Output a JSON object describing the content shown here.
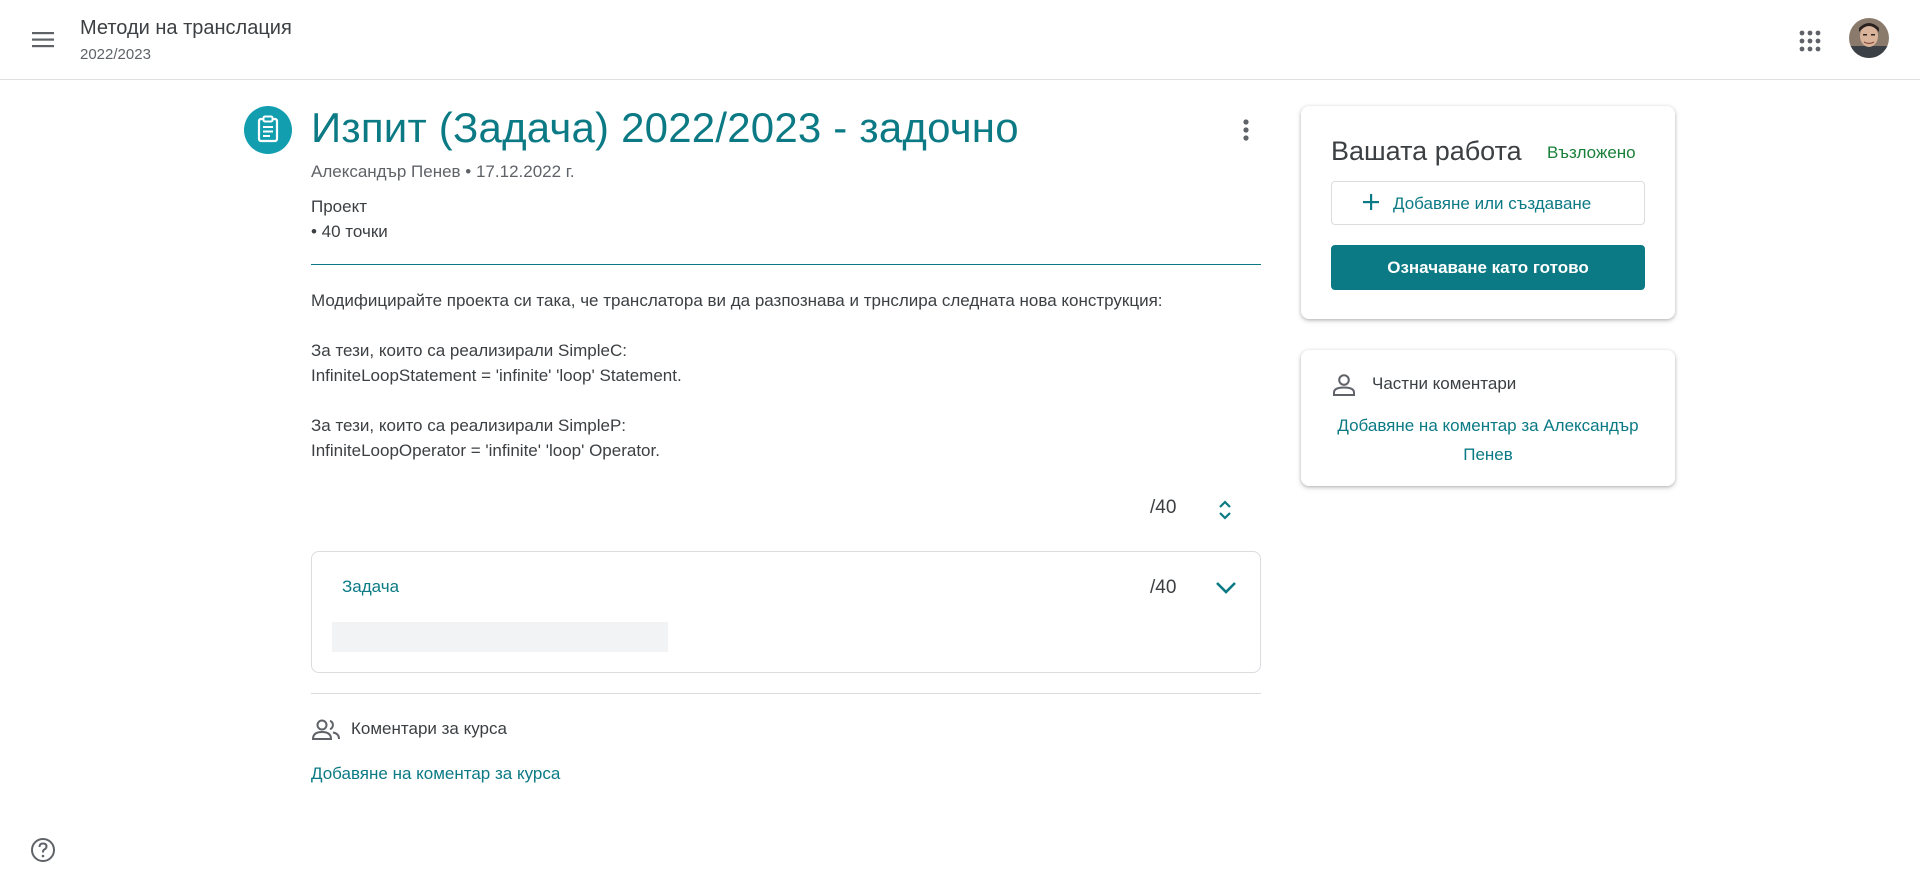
{
  "header": {
    "course_title": "Методи на транслация",
    "course_subtitle": "2022/2023"
  },
  "assignment": {
    "title": "Изпит (Задача) 2022/2023 - задочно",
    "meta": "Александър Пенев • 17.12.2022 г.",
    "type": "Проект",
    "points": "• 40 точки",
    "description": "Модифицирайте проекта си така, че транслатора ви да разпознава и трнслира следната нова конструкция:\n\nЗа тези, които са реализирали SimpleC:\nInfiniteLoopStatement = 'infinite' 'loop' Statement.\n\nЗа тези, които са реализирали SimpleP:\nInfiniteLoopOperator = 'infinite' 'loop' Operator.",
    "grade_total": "/40"
  },
  "rubric": {
    "name": "Задача",
    "score": "/40"
  },
  "class_comments": {
    "title": "Коментари за курса",
    "add_label": "Добавяне на коментар за курса"
  },
  "your_work": {
    "title": "Вашата работа",
    "status": "Възложено",
    "add_label": "Добавяне или създаване",
    "done_label": "Означаване като готово"
  },
  "private_comments": {
    "title": "Частни коментари",
    "add_label": "Добавяне на коментар за Александър Пенев"
  },
  "colors": {
    "accent": "#0b7a84",
    "icon_circle": "#129eaf",
    "status_green": "#188038"
  },
  "icons": {
    "menu": "menu-icon",
    "apps": "apps-grid-icon",
    "assignment": "assignment-icon",
    "more": "more-vert-icon",
    "grade_toggle": "unfold-icon",
    "chevron": "chevron-down-icon",
    "class_comments": "people-icon",
    "private_comments": "person-icon",
    "add": "plus-icon",
    "help": "help-icon"
  }
}
